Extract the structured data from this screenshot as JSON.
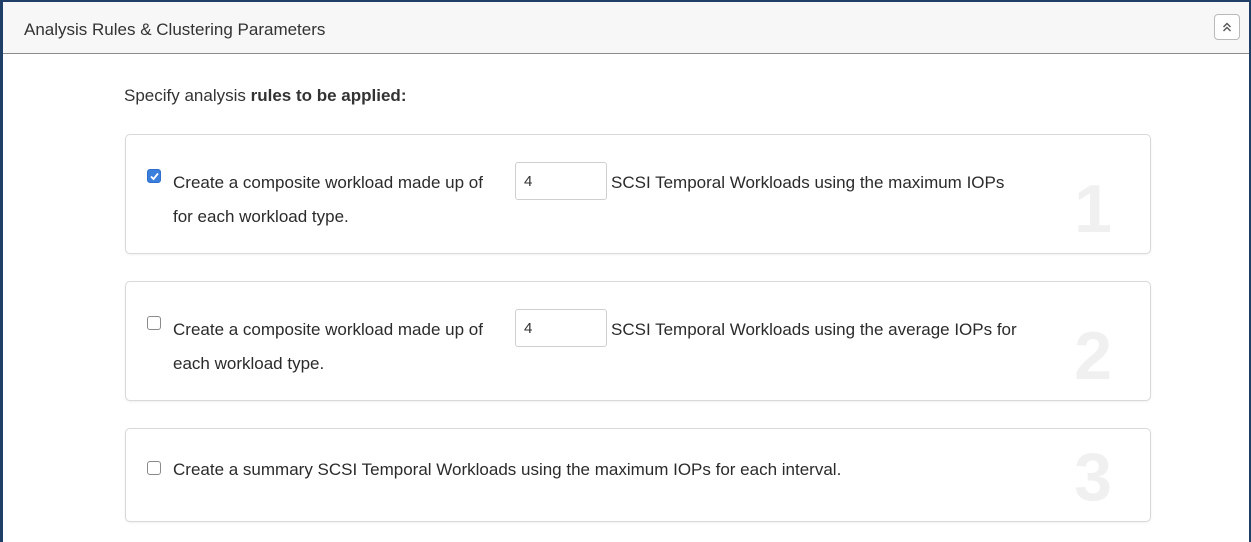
{
  "panel": {
    "title": "Analysis Rules & Clustering Parameters",
    "collapse_icon": "double-chevron-up-icon"
  },
  "intro": {
    "text": "Specify analysis ",
    "bold_text": "rules to be applied:"
  },
  "rules": [
    {
      "number": "1",
      "checked": true,
      "text_before": "Create a composite workload made up of",
      "count_value": "4",
      "text_after": "SCSI Temporal Workloads using the maximum IOPs",
      "text_line2": "for each workload type."
    },
    {
      "number": "2",
      "checked": false,
      "text_before": "Create a composite workload made up of",
      "count_value": "4",
      "text_after": "SCSI Temporal Workloads using the average IOPs for",
      "text_line2": "each workload type."
    },
    {
      "number": "3",
      "checked": false,
      "text": "Create a summary SCSI Temporal Workloads using the maximum IOPs for each interval."
    }
  ],
  "colors": {
    "accent": "#3b7fdd",
    "frame": "#1f3f66"
  }
}
